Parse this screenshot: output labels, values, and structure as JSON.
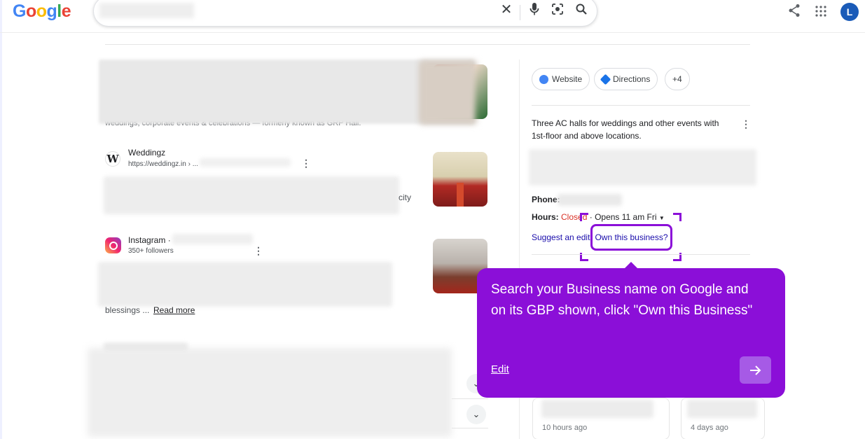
{
  "header": {
    "logo_text": "Google",
    "clear_icon": "close-icon",
    "mic_icon": "microphone-icon",
    "lens_icon": "camera-lens-icon",
    "search_icon": "search-icon",
    "share_icon": "share-icon",
    "apps_icon": "apps-grid-icon",
    "avatar_letter": "L"
  },
  "results": {
    "first_snippet_fragment": "weddings, corporate events & celebrations — formerly known as GRP Hall.",
    "weddingz": {
      "favicon_letter": "W",
      "title": "Weddingz",
      "url": "https://weddingz.in › ...",
      "snippet_fragment": "city"
    },
    "instagram": {
      "title": "Instagram ·",
      "followers": "350+ followers",
      "snippet_end": "blessings ...",
      "read_more": "Read more"
    }
  },
  "knowledge_panel": {
    "chips": {
      "website": "Website",
      "directions": "Directions",
      "more": "+4"
    },
    "description": "Three AC halls for weddings and other events with 1st-floor and above locations.",
    "phone_label": "Phone:",
    "hours_label": "Hours:",
    "hours_status": "Closed",
    "hours_sep": "·",
    "hours_open": "Opens 11 am Fri",
    "suggest_edit": "Suggest an edit",
    "own_business": "Own this business?",
    "review_cards": [
      {
        "time": "10 hours ago"
      },
      {
        "time": "4 days ago"
      }
    ]
  },
  "tooltip": {
    "text": "Search your Business name on Google and on its GBP shown, click \"Own this Business\"",
    "edit": "Edit",
    "next_icon": "arrow-right-icon"
  },
  "colors": {
    "accent": "#8b0fd8",
    "link": "#1a0dab",
    "closed": "#d93025"
  }
}
